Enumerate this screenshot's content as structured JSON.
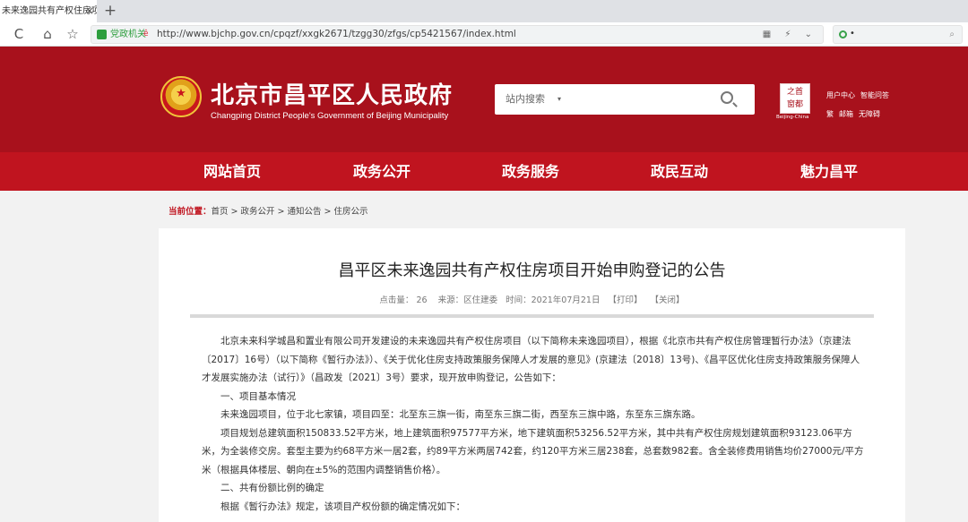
{
  "browser": {
    "tab_title": "未来逸园共有产权住房项",
    "tab_close": "×",
    "new_tab": "+",
    "back": "‹",
    "forward": "›",
    "refresh": "C",
    "home": "⌂",
    "star": "☆",
    "url_badge": "党政机关",
    "url": "http://www.bjchp.gov.cn/cpqzf/xxgk2671/tzgg30/zfgs/cp5421567/index.html",
    "url_icons": "▦ ⚡ ⌄",
    "search_text": "•",
    "search_icon": "⌕"
  },
  "header": {
    "title": "北京市昌平区人民政府",
    "subtitle": "Changping District People's Government of Beijing Municipality",
    "search_placeholder": "站内搜索",
    "search_caret": "▾",
    "capital_logo_text": "之首\n窗都",
    "capital_caption": "Beijing-China",
    "links": [
      "用户中心",
      "智能问答",
      "繁",
      "邮箱",
      "无障碍"
    ]
  },
  "nav": {
    "items": [
      "网站首页",
      "政务公开",
      "政务服务",
      "政民互动",
      "魅力昌平"
    ]
  },
  "breadcrumb": {
    "label": "当前位置：",
    "path": "首页 > 政务公开 > 通知公告 > 住房公示"
  },
  "article": {
    "title": "昌平区未来逸园共有产权住房项目开始申购登记的公告",
    "meta": {
      "clicks_label": "点击量：",
      "clicks": "26",
      "source": "来源：区住建委",
      "time": "时间：2021年07月21日",
      "print": "【打印】",
      "close": "【关闭】"
    },
    "paragraphs": [
      "北京未来科学城昌和置业有限公司开发建设的未来逸园共有产权住房项目（以下简称未来逸园项目），根据《北京市共有产权住房管理暂行办法》（京建法〔2017〕16号）（以下简称《暂行办法》）、《关于优化住房支持政策服务保障人才发展的意见》(京建法〔2018〕13号)、《昌平区优化住房支持政策服务保障人才发展实施办法（试行）》（昌政发〔2021〕3号）要求，现开放申购登记，公告如下：",
      "一、项目基本情况",
      "未来逸园项目，位于北七家镇，项目四至：北至东三旗一街，南至东三旗二街，西至东三旗中路，东至东三旗东路。",
      "项目规划总建筑面积150833.52平方米，地上建筑面积97577平方米，地下建筑面积53256.52平方米，其中共有产权住房规划建筑面积93123.06平方米，为全装修交房。套型主要为约68平方米一居2套，约89平方米两居742套，约120平方米三居238套，总套数982套。含全装修费用销售均价27000元/平方米（根据具体楼层、朝向在±5%的范围内调整销售价格）。",
      "二、共有份额比例的确定",
      "根据《暂行办法》规定，该项目产权份额的确定情况如下："
    ]
  }
}
